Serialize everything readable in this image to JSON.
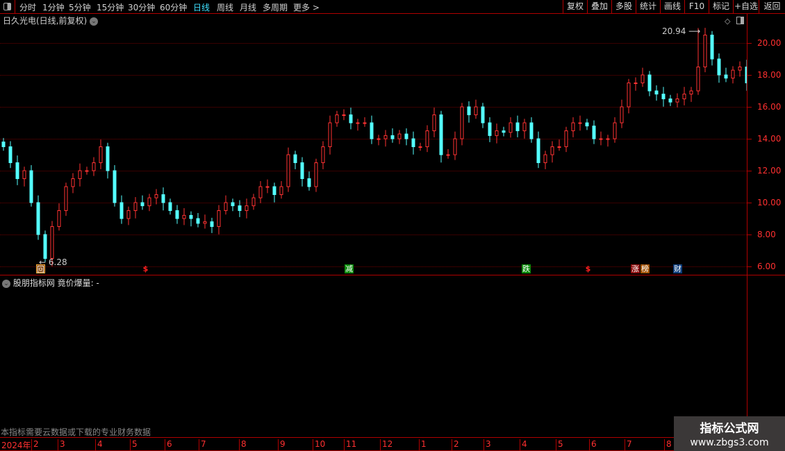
{
  "toolbar": {
    "periods": [
      "分时",
      "1分钟",
      "5分钟",
      "15分钟",
      "30分钟",
      "60分钟",
      "日线",
      "周线",
      "月线",
      "多周期",
      "更多 >"
    ],
    "active": "日线",
    "right_buttons": [
      "复权",
      "叠加",
      "多股",
      "统计",
      "画线",
      "F10",
      "标记",
      "+自选",
      "返回"
    ]
  },
  "chart_header": {
    "title": "日久光电(日线,前复权)"
  },
  "lower_panel": {
    "title": "股朋指标网 竟价爆量: -",
    "notice": "本指标需要云数据或下载的专业财务数据"
  },
  "markers": [
    {
      "label": "回",
      "bg": "#7a3c00",
      "x": "2024-02"
    },
    {
      "label": "$",
      "bg": "transparent"
    },
    {
      "label": "减",
      "bg": "#0a8a0a"
    },
    {
      "label": "跌",
      "bg": "#0a8a0a"
    },
    {
      "label": "$",
      "bg": "transparent"
    },
    {
      "label": "涨",
      "bg": "#8a0a0a"
    },
    {
      "label": "榜",
      "bg": "#a05000"
    },
    {
      "label": "财",
      "bg": "#0a3c7a"
    }
  ],
  "date_axis": [
    "2024年",
    "2",
    "3",
    "4",
    "5",
    "6",
    "7",
    "8",
    "9",
    "10",
    "11",
    "12",
    "1",
    "2",
    "3",
    "4",
    "5",
    "6",
    "7",
    "8"
  ],
  "watermark": {
    "name": "指标公式网",
    "url": "www.zbgs3.com"
  },
  "colors": {
    "up": "#ff3232",
    "down": "#54ffff",
    "axis": "#b00000"
  },
  "chart_data": {
    "type": "candlestick",
    "y_ticks": [
      "20.00",
      "18.00",
      "16.00",
      "14.00",
      "12.00",
      "10.00",
      "8.00",
      "6.00"
    ],
    "ylim": [
      6,
      20
    ],
    "max_label": "20.94",
    "min_label": "6.28",
    "closes": [
      13.5,
      12.5,
      11.5,
      12,
      10,
      8,
      6.5,
      8.5,
      9.5,
      11,
      11.5,
      12,
      12,
      12.5,
      13.5,
      12,
      10,
      9,
      9.5,
      10,
      9.8,
      10.3,
      10.5,
      10,
      9.5,
      9,
      9.2,
      9,
      8.7,
      8.8,
      8.5,
      9.5,
      10,
      9.8,
      9.5,
      9.8,
      10.3,
      11,
      11,
      10.5,
      11,
      13,
      12.5,
      11.5,
      11,
      12.5,
      13.5,
      15,
      15.5,
      15.5,
      15,
      15,
      15,
      14,
      14,
      14.2,
      14,
      14.3,
      14,
      13.5,
      13.5,
      14.5,
      15.5,
      13,
      13,
      14,
      16,
      15.5,
      16,
      15,
      14.2,
      14.5,
      14.4,
      15,
      14.5,
      15,
      14,
      12.5,
      13,
      13.5,
      13.5,
      14.5,
      15,
      15,
      14.8,
      14,
      14,
      14,
      15,
      16,
      17.5,
      17.5,
      18,
      17,
      16.8,
      16.5,
      16.3,
      16.5,
      16.8,
      17,
      18.5,
      20.5,
      19,
      18,
      17.8,
      18.3,
      18.5,
      17.5
    ]
  }
}
